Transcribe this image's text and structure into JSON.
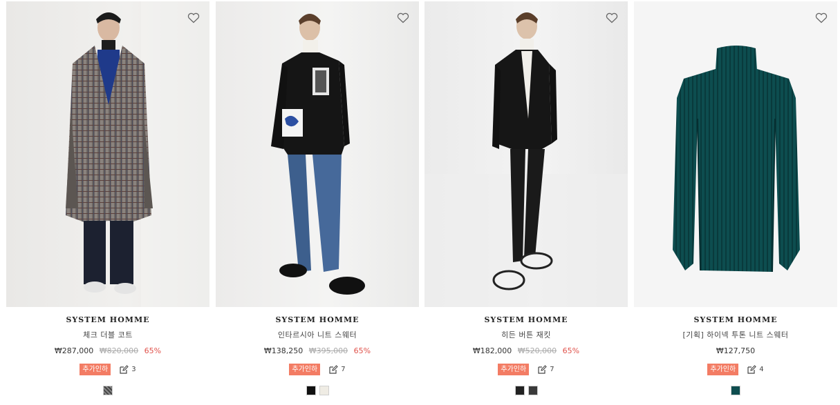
{
  "products": [
    {
      "brand": "SYSTEM HOMME",
      "name": "체크 더블 코트",
      "price": "₩287,000",
      "original_price": "₩820,000",
      "discount": "65%",
      "coupon_label": "추가인하",
      "review_count": "3",
      "swatches": [
        "check-pattern"
      ],
      "image": "model-check-double-coat"
    },
    {
      "brand": "SYSTEM HOMME",
      "name": "인타르시아 니트 스웨터",
      "price": "₩138,250",
      "original_price": "₩395,000",
      "discount": "65%",
      "coupon_label": "추가인하",
      "review_count": "7",
      "swatches": [
        "#111111",
        "#efece4"
      ],
      "image": "model-intarsia-knit-sweater"
    },
    {
      "brand": "SYSTEM HOMME",
      "name": "히든 버튼 재킷",
      "price": "₩182,000",
      "original_price": "₩520,000",
      "discount": "65%",
      "coupon_label": "추가인하",
      "review_count": "7",
      "swatches": [
        "#222222",
        "#3a3a3a"
      ],
      "image": "model-hidden-button-jacket"
    },
    {
      "brand": "SYSTEM HOMME",
      "name": "[기획] 하이넥 투톤 니트 스웨터",
      "price": "₩127,750",
      "original_price": "",
      "discount": "",
      "coupon_label": "추가인하",
      "review_count": "4",
      "swatches": [
        "#0e4d4f"
      ],
      "image": "product-highneck-knit-sweater"
    }
  ],
  "icons": {
    "wishlist": "heart-icon",
    "review": "edit-review-icon"
  },
  "colors": {
    "coupon_bg": "#f37c64",
    "discount_text": "#e0524b"
  }
}
